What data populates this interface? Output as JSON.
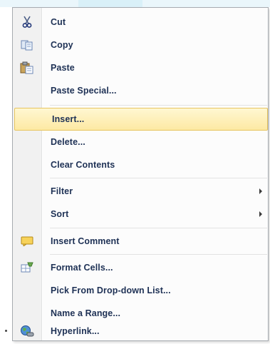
{
  "menu": {
    "items": [
      {
        "label": "Cut",
        "icon": "scissors-icon"
      },
      {
        "label": "Copy",
        "icon": "copy-icon"
      },
      {
        "label": "Paste",
        "icon": "paste-icon"
      },
      {
        "label": "Paste Special..."
      },
      {
        "label": "Insert...",
        "highlighted": true
      },
      {
        "label": "Delete..."
      },
      {
        "label": "Clear Contents"
      },
      {
        "label": "Filter",
        "submenu": true
      },
      {
        "label": "Sort",
        "submenu": true
      },
      {
        "label": "Insert Comment",
        "icon": "comment-icon"
      },
      {
        "label": "Format Cells...",
        "icon": "format-cells-icon"
      },
      {
        "label": "Pick From Drop-down List..."
      },
      {
        "label": "Name a Range..."
      },
      {
        "label": "Hyperlink...",
        "icon": "hyperlink-globe-icon"
      }
    ]
  },
  "colors": {
    "highlight": "#fde9a3",
    "highlight_border": "#e7c560",
    "text": "#1e3155",
    "gutter": "#f1f1f1"
  }
}
